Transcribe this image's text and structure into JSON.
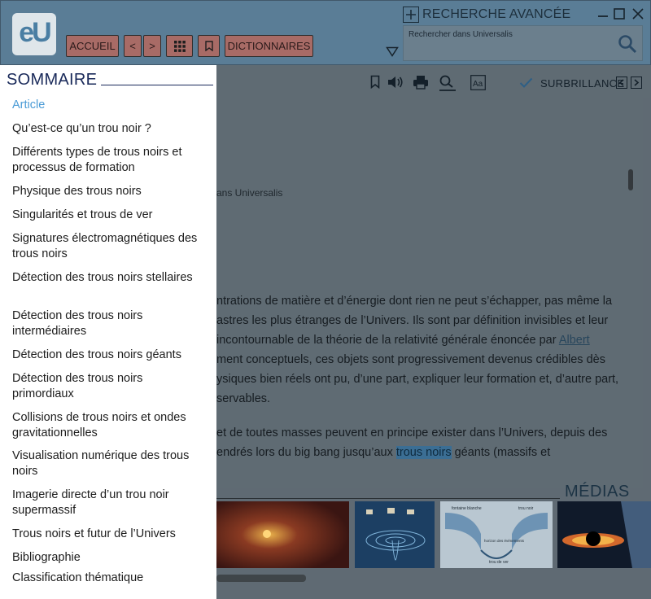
{
  "header": {
    "logo_text": "eU",
    "buttons": {
      "accueil": "ACCUEIL",
      "prev": "<",
      "next": ">",
      "dictionnaires": "DICTIONNAIRES"
    },
    "recherche_avancee": "RECHERCHE AVANCÉE",
    "search_placeholder": "Rechercher dans Universalis"
  },
  "toolbar": {
    "surbrillance": "SURBRILLANCE"
  },
  "article": {
    "meta": "ans Universalis",
    "lines": [
      "ntrations de matière et d’énergie dont rien ne peut s’échapper, pas même la",
      "astres les plus étranges de l’Univers. Ils sont par définition invisibles et leur",
      " incontournable de la théorie de la relativité générale énoncée par ",
      "ment conceptuels, ces objets sont progressivement devenus crédibles dès",
      "ysiques bien réels ont pu, d’une part, expliquer leur formation et, d’autre part,",
      "servables."
    ],
    "link_text": "Albert",
    "lines2": [
      " et de toutes masses peuvent en principe exister dans l’Univers, depuis des",
      "endrés lors du big bang jusqu’aux "
    ],
    "highlight": "trous noirs",
    "line2_tail": " géants (massifs et"
  },
  "medias": {
    "title": "MÉDIAS",
    "diagram_labels": [
      "fontaine blanche",
      "trou noir",
      "horizon des événements",
      "trou de ver"
    ]
  },
  "sommaire": {
    "title": "SOMMAIRE",
    "items": [
      {
        "label": "Article",
        "active": true
      },
      {
        "label": "Qu’est-ce qu’un trou noir ?"
      },
      {
        "label": "Différents types de trous noirs et processus de formation"
      },
      {
        "label": "Physique des trous noirs"
      },
      {
        "label": "Singularités et trous de ver"
      },
      {
        "label": "Signatures électromagnétiques des trous noirs"
      },
      {
        "label": "Détection des trous noirs stellaires"
      },
      {
        "label": "Détection des trous noirs intermédiaires"
      },
      {
        "label": "Détection des trous noirs géants"
      },
      {
        "label": "Détection des trous noirs primordiaux"
      },
      {
        "label": "Collisions de trous noirs et ondes gravitationnelles"
      },
      {
        "label": "Visualisation numérique des trous noirs"
      },
      {
        "label": "Imagerie directe d’un trou noir supermassif"
      },
      {
        "label": "Trous noirs et futur de l’Univers"
      },
      {
        "label": "Bibliographie"
      },
      {
        "label": "Classification thématique"
      }
    ]
  },
  "colors": {
    "header_bg": "#5a7d96",
    "button_bg": "#a86b66",
    "active_link": "#4a9bd6",
    "highlight": "#3b6e94"
  },
  "icons": [
    "plus-icon",
    "minimize-icon",
    "maximize-icon",
    "close-icon",
    "search-icon",
    "triangle-down-icon",
    "grid-icon",
    "bookmark-icon",
    "speaker-icon",
    "print-icon",
    "search-person-icon",
    "font-size-icon",
    "check-icon",
    "chevron-left-icon",
    "chevron-right-icon"
  ]
}
